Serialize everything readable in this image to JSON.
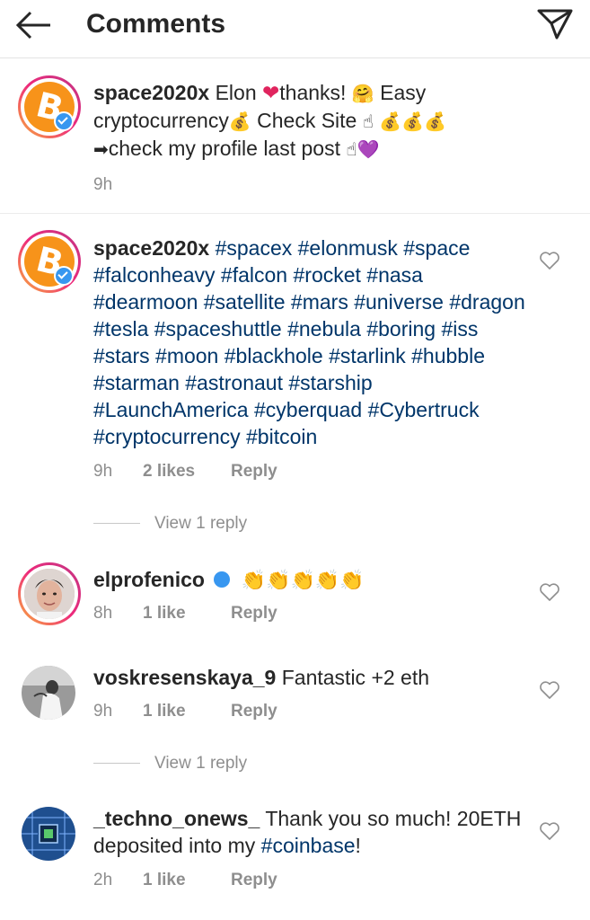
{
  "header": {
    "title": "Comments"
  },
  "comments": [
    {
      "username": "space2020x",
      "text_before": " Elon ",
      "heart": "❤",
      "text_mid": "thanks! ",
      "hug": "🤗",
      "text_a": " Easy cryptocurrency",
      "bag1": "💰",
      "text_b": " Check Site ",
      "point1": "☝",
      "bags": "💰💰💰",
      "arrow": "➡",
      "text_c": "check my profile last post ",
      "point2": "☝",
      "purple_heart": "💜",
      "time": "9h"
    },
    {
      "username": "space2020x",
      "hashtags": "#spacex #elonmusk #space #falconheavy #falcon #rocket #nasa #dearmoon #satellite #mars #universe #dragon #tesla #spaceshuttle #nebula #boring #iss #stars #moon #blackhole #starlink #hubble #starman #astronaut #starship #LaunchAmerica #cyberquad #Cybertruck #cryptocurrency #bitcoin",
      "time": "9h",
      "likes": "2 likes",
      "reply": "Reply",
      "view_replies": "View 1 reply"
    },
    {
      "username": "elprofenico",
      "claps": "👏👏👏👏👏",
      "time": "8h",
      "likes": "1 like",
      "reply": "Reply"
    },
    {
      "username": "voskresenskaya_9",
      "text": " Fantastic +2 eth",
      "time": "9h",
      "likes": "1 like",
      "reply": "Reply",
      "view_replies": "View 1 reply"
    },
    {
      "username": "_techno_onews_",
      "text_a": " Thank you so much! 20ETH deposited into my ",
      "hashtag": "#coinbase",
      "text_b": "!",
      "time": "2h",
      "likes": "1 like",
      "reply": "Reply"
    }
  ],
  "icons": {
    "back": "back-arrow-icon",
    "send": "direct-send-icon",
    "like": "heart-outline-icon",
    "verified": "verified-badge-icon"
  },
  "colors": {
    "hashtag": "#003569",
    "verified": "#3897f0",
    "bitcoin": "#f7931a",
    "muted": "#8e8e8e"
  }
}
